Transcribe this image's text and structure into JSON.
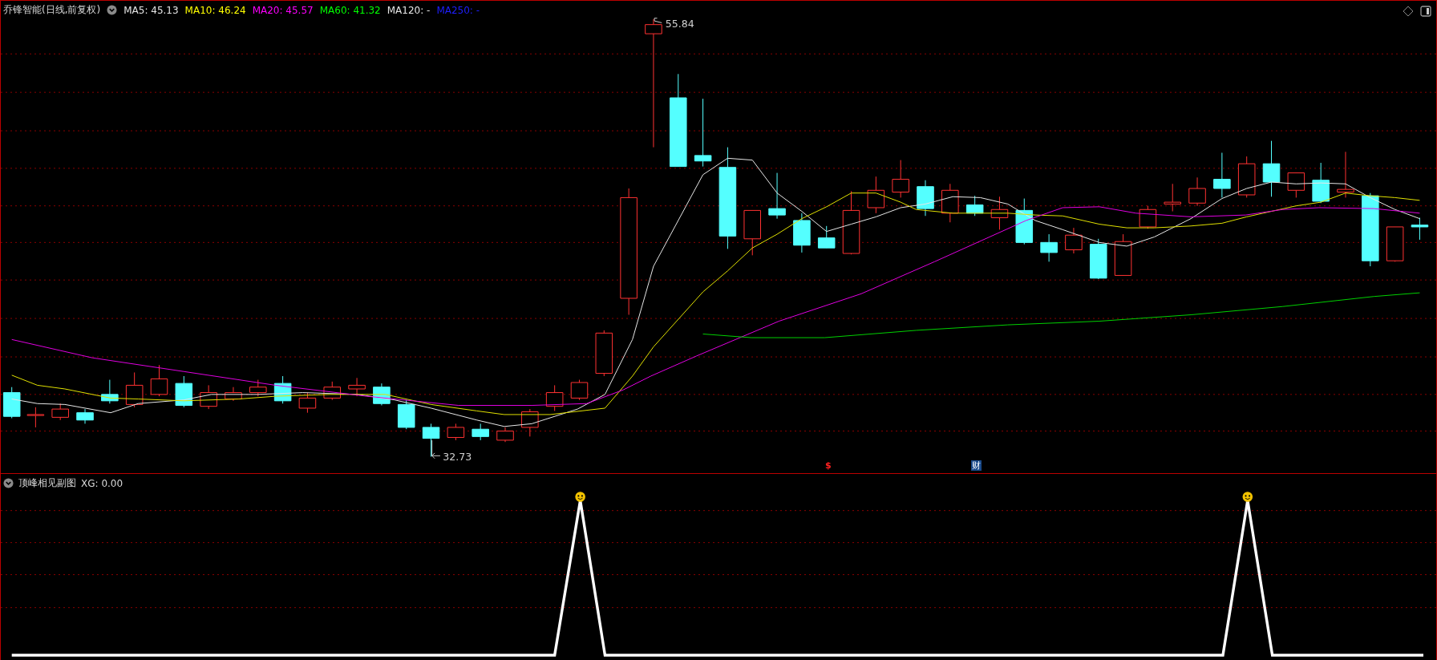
{
  "title": {
    "stock": "乔锋智能(日线,前复权)",
    "indicators": [
      {
        "label": "MA5: 45.13",
        "color": "#e6e6e6"
      },
      {
        "label": "MA10: 46.24",
        "color": "#ffff00"
      },
      {
        "label": "MA20: 45.57",
        "color": "#ff00ff"
      },
      {
        "label": "MA60: 41.32",
        "color": "#00ff00"
      },
      {
        "label": "MA120: -",
        "color": "#e6e6e6"
      },
      {
        "label": "MA250: -",
        "color": "#1f1fff"
      }
    ]
  },
  "main_chart": {
    "high_label": "55.84",
    "low_label": "32.73",
    "markers": [
      {
        "kind": "dividend",
        "text": "$"
      },
      {
        "kind": "finance",
        "text": "财"
      }
    ]
  },
  "sub_chart": {
    "title": "顶峰相见副图",
    "reading": "XG: 0.00"
  }
}
